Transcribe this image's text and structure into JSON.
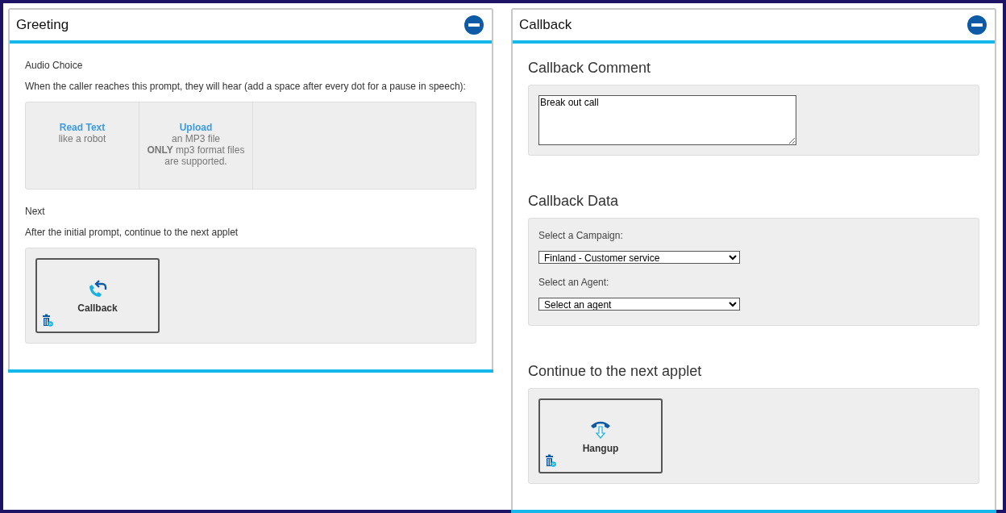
{
  "greeting": {
    "title": "Greeting",
    "expanded": true,
    "audio_choice": {
      "label": "Audio Choice",
      "description": "When the caller reaches this prompt, they will hear (add a space after every dot for a pause in speech):",
      "options": [
        {
          "title": "Read Text",
          "lines": [
            "like a robot"
          ]
        },
        {
          "title": "Upload",
          "lines": [
            "an MP3 file",
            "**ONLY** mp3 format files are supported."
          ]
        }
      ]
    },
    "next": {
      "label": "Next",
      "description": "After the initial prompt, continue to the next applet",
      "applet": {
        "name": "Callback",
        "kind": "callback"
      }
    }
  },
  "callback": {
    "title": "Callback",
    "expanded": true,
    "comment": {
      "heading": "Callback Comment",
      "value": "Break out call"
    },
    "data": {
      "heading": "Callback Data",
      "fields": [
        {
          "label": "Select a Campaign:",
          "value": "Finland - Customer service"
        },
        {
          "label": "Select an Agent:",
          "value": "Select an agent"
        }
      ]
    },
    "next": {
      "heading": "Continue to the next applet",
      "applet": {
        "name": "Hangup",
        "kind": "hangup"
      }
    }
  }
}
